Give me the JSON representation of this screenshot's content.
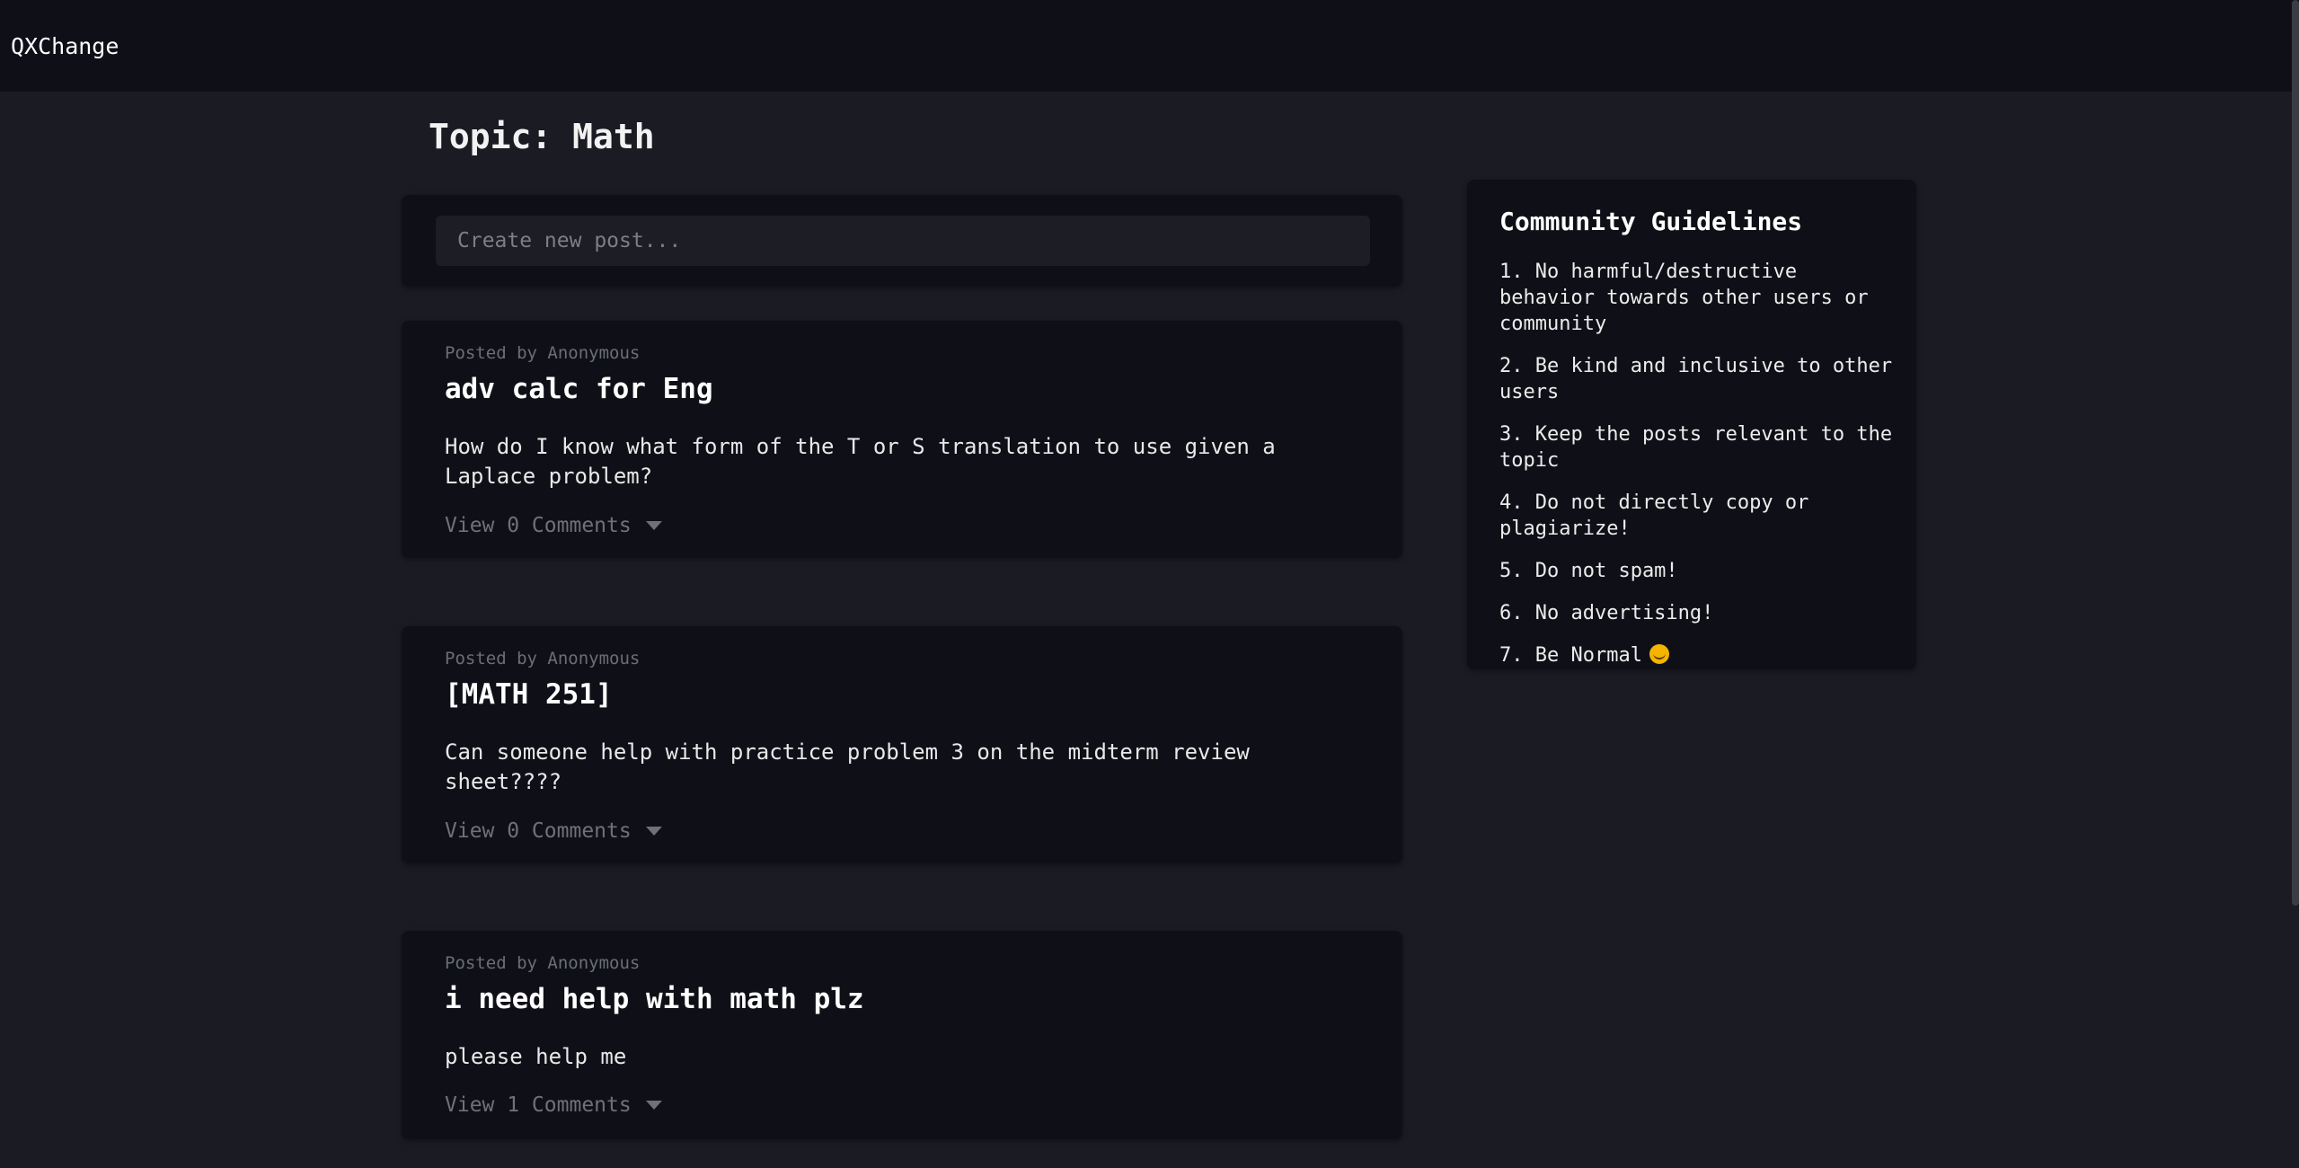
{
  "header": {
    "brand": "QXChange"
  },
  "page": {
    "title": "Topic: Math"
  },
  "composer": {
    "placeholder": "Create new post..."
  },
  "posts": [
    {
      "meta": "Posted by Anonymous",
      "title": "adv calc for Eng",
      "body": "How do I know what form of the T or S translation to use given a Laplace problem?",
      "comments": "View 0 Comments"
    },
    {
      "meta": "Posted by Anonymous",
      "title": "[MATH 251]",
      "body": "Can someone help with practice problem 3 on the midterm review sheet????",
      "comments": "View 0 Comments"
    },
    {
      "meta": "Posted by Anonymous",
      "title": "i need help with math plz",
      "body": "please help me",
      "comments": "View 1 Comments"
    }
  ],
  "guidelines": {
    "title": "Community Guidelines",
    "items": [
      "1. No harmful/destructive behavior towards other users or community",
      "2. Be kind and inclusive to other users",
      "3. Keep the posts relevant to the topic",
      "4. Do not directly copy or plagiarize!",
      "5. Do not spam!",
      "6. No advertising!",
      "7. Be Normal"
    ],
    "last_item_icon": "smiling-face-icon"
  }
}
